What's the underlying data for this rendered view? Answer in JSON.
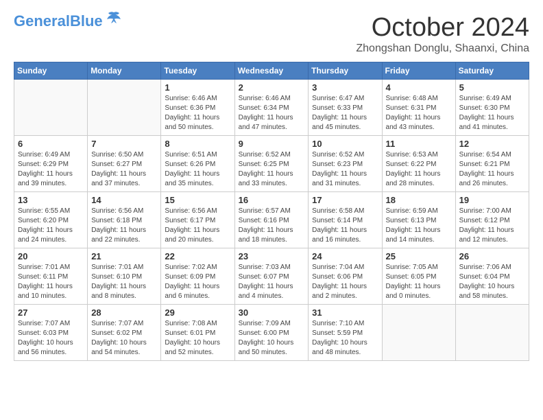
{
  "header": {
    "logo_general": "General",
    "logo_blue": "Blue",
    "month": "October 2024",
    "location": "Zhongshan Donglu, Shaanxi, China"
  },
  "days_of_week": [
    "Sunday",
    "Monday",
    "Tuesday",
    "Wednesday",
    "Thursday",
    "Friday",
    "Saturday"
  ],
  "weeks": [
    [
      {
        "day": "",
        "sunrise": "",
        "sunset": "",
        "daylight": ""
      },
      {
        "day": "",
        "sunrise": "",
        "sunset": "",
        "daylight": ""
      },
      {
        "day": "1",
        "sunrise": "Sunrise: 6:46 AM",
        "sunset": "Sunset: 6:36 PM",
        "daylight": "Daylight: 11 hours and 50 minutes."
      },
      {
        "day": "2",
        "sunrise": "Sunrise: 6:46 AM",
        "sunset": "Sunset: 6:34 PM",
        "daylight": "Daylight: 11 hours and 47 minutes."
      },
      {
        "day": "3",
        "sunrise": "Sunrise: 6:47 AM",
        "sunset": "Sunset: 6:33 PM",
        "daylight": "Daylight: 11 hours and 45 minutes."
      },
      {
        "day": "4",
        "sunrise": "Sunrise: 6:48 AM",
        "sunset": "Sunset: 6:31 PM",
        "daylight": "Daylight: 11 hours and 43 minutes."
      },
      {
        "day": "5",
        "sunrise": "Sunrise: 6:49 AM",
        "sunset": "Sunset: 6:30 PM",
        "daylight": "Daylight: 11 hours and 41 minutes."
      }
    ],
    [
      {
        "day": "6",
        "sunrise": "Sunrise: 6:49 AM",
        "sunset": "Sunset: 6:29 PM",
        "daylight": "Daylight: 11 hours and 39 minutes."
      },
      {
        "day": "7",
        "sunrise": "Sunrise: 6:50 AM",
        "sunset": "Sunset: 6:27 PM",
        "daylight": "Daylight: 11 hours and 37 minutes."
      },
      {
        "day": "8",
        "sunrise": "Sunrise: 6:51 AM",
        "sunset": "Sunset: 6:26 PM",
        "daylight": "Daylight: 11 hours and 35 minutes."
      },
      {
        "day": "9",
        "sunrise": "Sunrise: 6:52 AM",
        "sunset": "Sunset: 6:25 PM",
        "daylight": "Daylight: 11 hours and 33 minutes."
      },
      {
        "day": "10",
        "sunrise": "Sunrise: 6:52 AM",
        "sunset": "Sunset: 6:23 PM",
        "daylight": "Daylight: 11 hours and 31 minutes."
      },
      {
        "day": "11",
        "sunrise": "Sunrise: 6:53 AM",
        "sunset": "Sunset: 6:22 PM",
        "daylight": "Daylight: 11 hours and 28 minutes."
      },
      {
        "day": "12",
        "sunrise": "Sunrise: 6:54 AM",
        "sunset": "Sunset: 6:21 PM",
        "daylight": "Daylight: 11 hours and 26 minutes."
      }
    ],
    [
      {
        "day": "13",
        "sunrise": "Sunrise: 6:55 AM",
        "sunset": "Sunset: 6:20 PM",
        "daylight": "Daylight: 11 hours and 24 minutes."
      },
      {
        "day": "14",
        "sunrise": "Sunrise: 6:56 AM",
        "sunset": "Sunset: 6:18 PM",
        "daylight": "Daylight: 11 hours and 22 minutes."
      },
      {
        "day": "15",
        "sunrise": "Sunrise: 6:56 AM",
        "sunset": "Sunset: 6:17 PM",
        "daylight": "Daylight: 11 hours and 20 minutes."
      },
      {
        "day": "16",
        "sunrise": "Sunrise: 6:57 AM",
        "sunset": "Sunset: 6:16 PM",
        "daylight": "Daylight: 11 hours and 18 minutes."
      },
      {
        "day": "17",
        "sunrise": "Sunrise: 6:58 AM",
        "sunset": "Sunset: 6:14 PM",
        "daylight": "Daylight: 11 hours and 16 minutes."
      },
      {
        "day": "18",
        "sunrise": "Sunrise: 6:59 AM",
        "sunset": "Sunset: 6:13 PM",
        "daylight": "Daylight: 11 hours and 14 minutes."
      },
      {
        "day": "19",
        "sunrise": "Sunrise: 7:00 AM",
        "sunset": "Sunset: 6:12 PM",
        "daylight": "Daylight: 11 hours and 12 minutes."
      }
    ],
    [
      {
        "day": "20",
        "sunrise": "Sunrise: 7:01 AM",
        "sunset": "Sunset: 6:11 PM",
        "daylight": "Daylight: 11 hours and 10 minutes."
      },
      {
        "day": "21",
        "sunrise": "Sunrise: 7:01 AM",
        "sunset": "Sunset: 6:10 PM",
        "daylight": "Daylight: 11 hours and 8 minutes."
      },
      {
        "day": "22",
        "sunrise": "Sunrise: 7:02 AM",
        "sunset": "Sunset: 6:09 PM",
        "daylight": "Daylight: 11 hours and 6 minutes."
      },
      {
        "day": "23",
        "sunrise": "Sunrise: 7:03 AM",
        "sunset": "Sunset: 6:07 PM",
        "daylight": "Daylight: 11 hours and 4 minutes."
      },
      {
        "day": "24",
        "sunrise": "Sunrise: 7:04 AM",
        "sunset": "Sunset: 6:06 PM",
        "daylight": "Daylight: 11 hours and 2 minutes."
      },
      {
        "day": "25",
        "sunrise": "Sunrise: 7:05 AM",
        "sunset": "Sunset: 6:05 PM",
        "daylight": "Daylight: 11 hours and 0 minutes."
      },
      {
        "day": "26",
        "sunrise": "Sunrise: 7:06 AM",
        "sunset": "Sunset: 6:04 PM",
        "daylight": "Daylight: 10 hours and 58 minutes."
      }
    ],
    [
      {
        "day": "27",
        "sunrise": "Sunrise: 7:07 AM",
        "sunset": "Sunset: 6:03 PM",
        "daylight": "Daylight: 10 hours and 56 minutes."
      },
      {
        "day": "28",
        "sunrise": "Sunrise: 7:07 AM",
        "sunset": "Sunset: 6:02 PM",
        "daylight": "Daylight: 10 hours and 54 minutes."
      },
      {
        "day": "29",
        "sunrise": "Sunrise: 7:08 AM",
        "sunset": "Sunset: 6:01 PM",
        "daylight": "Daylight: 10 hours and 52 minutes."
      },
      {
        "day": "30",
        "sunrise": "Sunrise: 7:09 AM",
        "sunset": "Sunset: 6:00 PM",
        "daylight": "Daylight: 10 hours and 50 minutes."
      },
      {
        "day": "31",
        "sunrise": "Sunrise: 7:10 AM",
        "sunset": "Sunset: 5:59 PM",
        "daylight": "Daylight: 10 hours and 48 minutes."
      },
      {
        "day": "",
        "sunrise": "",
        "sunset": "",
        "daylight": ""
      },
      {
        "day": "",
        "sunrise": "",
        "sunset": "",
        "daylight": ""
      }
    ]
  ]
}
